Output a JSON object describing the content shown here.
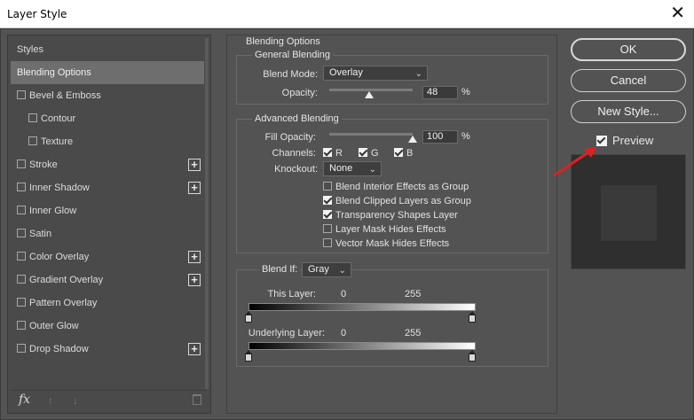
{
  "window": {
    "title": "Layer Style",
    "close_glyph": "✕"
  },
  "left_panel": {
    "items": [
      {
        "label": "Styles",
        "checkbox": false,
        "plus": false,
        "selected": false,
        "indent": false
      },
      {
        "label": "Blending Options",
        "checkbox": false,
        "plus": false,
        "selected": true,
        "indent": false
      },
      {
        "label": "Bevel & Emboss",
        "checkbox": true,
        "plus": false,
        "selected": false,
        "indent": false
      },
      {
        "label": "Contour",
        "checkbox": true,
        "plus": false,
        "selected": false,
        "indent": true
      },
      {
        "label": "Texture",
        "checkbox": true,
        "plus": false,
        "selected": false,
        "indent": true
      },
      {
        "label": "Stroke",
        "checkbox": true,
        "plus": true,
        "selected": false,
        "indent": false
      },
      {
        "label": "Inner Shadow",
        "checkbox": true,
        "plus": true,
        "selected": false,
        "indent": false
      },
      {
        "label": "Inner Glow",
        "checkbox": true,
        "plus": false,
        "selected": false,
        "indent": false
      },
      {
        "label": "Satin",
        "checkbox": true,
        "plus": false,
        "selected": false,
        "indent": false
      },
      {
        "label": "Color Overlay",
        "checkbox": true,
        "plus": true,
        "selected": false,
        "indent": false
      },
      {
        "label": "Gradient Overlay",
        "checkbox": true,
        "plus": true,
        "selected": false,
        "indent": false
      },
      {
        "label": "Pattern Overlay",
        "checkbox": true,
        "plus": false,
        "selected": false,
        "indent": false
      },
      {
        "label": "Outer Glow",
        "checkbox": true,
        "plus": false,
        "selected": false,
        "indent": false
      },
      {
        "label": "Drop Shadow",
        "checkbox": true,
        "plus": true,
        "selected": false,
        "indent": false
      }
    ],
    "fx_label": "fx",
    "plus_glyph": "+",
    "up_glyph": "↑",
    "down_glyph": "↓"
  },
  "blending": {
    "section_title": "Blending Options",
    "general_title": "General Blending",
    "blend_mode_label": "Blend Mode:",
    "blend_mode_value": "Overlay",
    "opacity_label": "Opacity:",
    "opacity_value": "48",
    "opacity_level": 0.48,
    "percent": "%",
    "advanced_title": "Advanced Blending",
    "fill_opacity_label": "Fill Opacity:",
    "fill_opacity_value": "100",
    "fill_opacity_level": 1.0,
    "channels_label": "Channels:",
    "channel_r": "R",
    "channel_g": "G",
    "channel_b": "B",
    "knockout_label": "Knockout:",
    "knockout_value": "None",
    "options": [
      {
        "label": "Blend Interior Effects as Group",
        "checked": false
      },
      {
        "label": "Blend Clipped Layers as Group",
        "checked": true
      },
      {
        "label": "Transparency Shapes Layer",
        "checked": true
      },
      {
        "label": "Layer Mask Hides Effects",
        "checked": false
      },
      {
        "label": "Vector Mask Hides Effects",
        "checked": false
      }
    ],
    "blend_if_label": "Blend If:",
    "blend_if_value": "Gray",
    "this_layer_label": "This Layer:",
    "this_layer_low": "0",
    "this_layer_high": "255",
    "underlying_label": "Underlying Layer:",
    "underlying_low": "0",
    "underlying_high": "255",
    "chevron": "⌄"
  },
  "buttons": {
    "ok": "OK",
    "cancel": "Cancel",
    "new_style": "New Style...",
    "preview_label": "Preview",
    "preview_checked": true
  },
  "colors": {
    "panel_bg": "#535353",
    "selected_item": "#6e6e6e",
    "annotation_arrow": "#e02020",
    "checkbox_accent": "#3d7be0"
  }
}
